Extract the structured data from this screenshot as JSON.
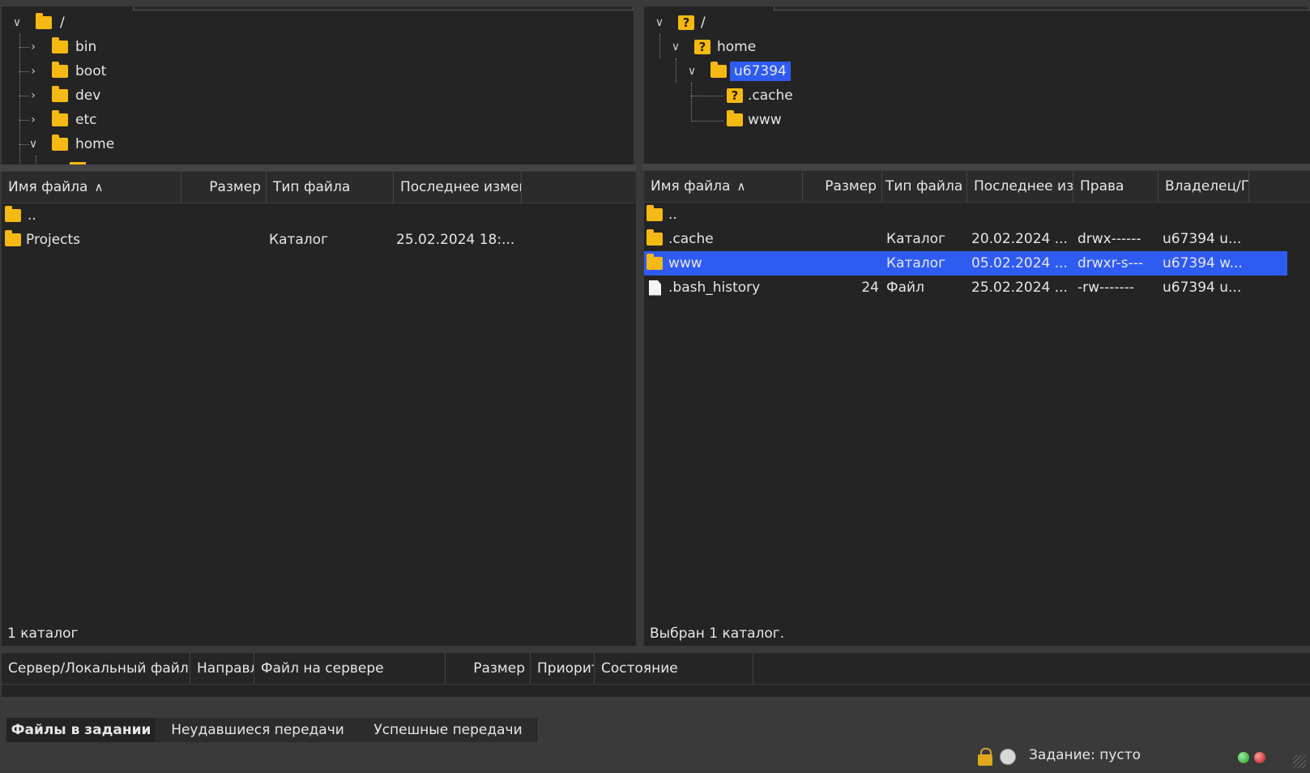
{
  "local_tree": {
    "root": "/",
    "items": [
      {
        "label": "bin"
      },
      {
        "label": "boot"
      },
      {
        "label": "dev"
      },
      {
        "label": "etc"
      },
      {
        "label": "home"
      }
    ]
  },
  "remote_tree": {
    "root": "/",
    "home": "home",
    "user": "u67394",
    "cache": ".cache",
    "www": "www"
  },
  "local_list": {
    "headers": [
      "Имя файла",
      "Размер",
      "Тип файла",
      "Последнее измен"
    ],
    "rows": [
      {
        "name": "..",
        "size": "",
        "type": "",
        "modified": ""
      },
      {
        "name": "Projects",
        "size": "",
        "type": "Каталог",
        "modified": "25.02.2024 18:..."
      }
    ],
    "status": "1 каталог"
  },
  "remote_list": {
    "headers": [
      "Имя файла",
      "Размер",
      "Тип файла",
      "Последнее изм",
      "Права",
      "Владелец/Гр"
    ],
    "rows": [
      {
        "name": "..",
        "size": "",
        "type": "",
        "modified": "",
        "perms": "",
        "owner": ""
      },
      {
        "name": ".cache",
        "size": "",
        "type": "Каталог",
        "modified": "20.02.2024 ...",
        "perms": "drwx------",
        "owner": "u67394 u..."
      },
      {
        "name": "www",
        "size": "",
        "type": "Каталог",
        "modified": "05.02.2024 ...",
        "perms": "drwxr-s---",
        "owner": "u67394 w..."
      },
      {
        "name": ".bash_history",
        "size": "24",
        "type": "Файл",
        "modified": "25.02.2024 ...",
        "perms": "-rw-------",
        "owner": "u67394 u..."
      }
    ],
    "status": "Выбран 1 каталог."
  },
  "queue": {
    "headers": [
      "Сервер/Локальный файл",
      "Направл",
      "Файл на сервере",
      "Размер",
      "Приорит",
      "Состояние"
    ]
  },
  "tabs": [
    "Файлы в задании",
    "Неудавшиеся передачи",
    "Успешные передачи"
  ],
  "statusbar": {
    "queue_text": "Задание: пусто",
    "icons": [
      "lock-icon",
      "speed-limit-icon",
      "green-led-icon",
      "red-led-icon"
    ]
  },
  "colors": {
    "selection": "#2f5cf0",
    "folder": "#f5b914",
    "panel_bg": "#242424"
  }
}
